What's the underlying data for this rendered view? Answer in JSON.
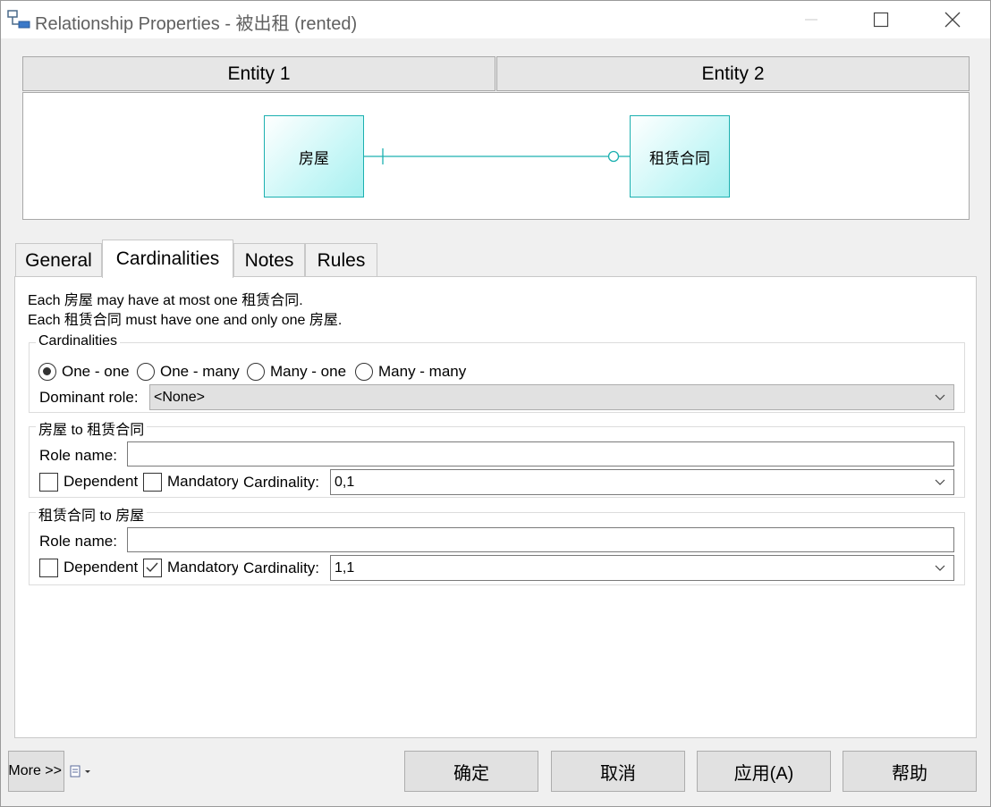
{
  "window": {
    "title": "Relationship Properties - 被出租 (rented)",
    "icon": "relationship-icon"
  },
  "entities": {
    "entity1_header": "Entity 1",
    "entity2_header": "Entity 2",
    "entity1_name": "房屋",
    "entity2_name": "租赁合同"
  },
  "tabs": [
    {
      "label": "General",
      "active": false
    },
    {
      "label": "Cardinalities",
      "active": true
    },
    {
      "label": "Notes",
      "active": false
    },
    {
      "label": "Rules",
      "active": false
    }
  ],
  "description": {
    "line1": "Each 房屋 may have at most one 租赁合同.",
    "line2": "Each 租赁合同 must have one and only one 房屋."
  },
  "cardinalities_group": {
    "title": "Cardinalities",
    "options": [
      {
        "label": "One - one",
        "checked": true
      },
      {
        "label": "One - many",
        "checked": false
      },
      {
        "label": "Many - one",
        "checked": false
      },
      {
        "label": "Many - many",
        "checked": false
      }
    ],
    "dominant_role_label": "Dominant role:",
    "dominant_role_value": "<None>"
  },
  "role_a_to_b": {
    "title": "房屋 to 租赁合同",
    "role_name_label": "Role name:",
    "role_name_value": "",
    "dependent_label": "Dependent",
    "dependent_checked": false,
    "mandatory_label": "Mandatory",
    "mandatory_checked": false,
    "cardinality_label": "Cardinality:",
    "cardinality_value": "0,1"
  },
  "role_b_to_a": {
    "title": "租赁合同 to 房屋",
    "role_name_label": "Role name:",
    "role_name_value": "",
    "dependent_label": "Dependent",
    "dependent_checked": false,
    "mandatory_label": "Mandatory",
    "mandatory_checked": true,
    "cardinality_label": "Cardinality:",
    "cardinality_value": "1,1"
  },
  "buttons": {
    "more": "More >>",
    "ok": "确定",
    "cancel": "取消",
    "apply": "应用(A)",
    "help": "帮助"
  },
  "colors": {
    "entity_border": "#1cb0b0",
    "entity_fill": "#c9f7f7",
    "relation_line": "#1cb0b0"
  }
}
